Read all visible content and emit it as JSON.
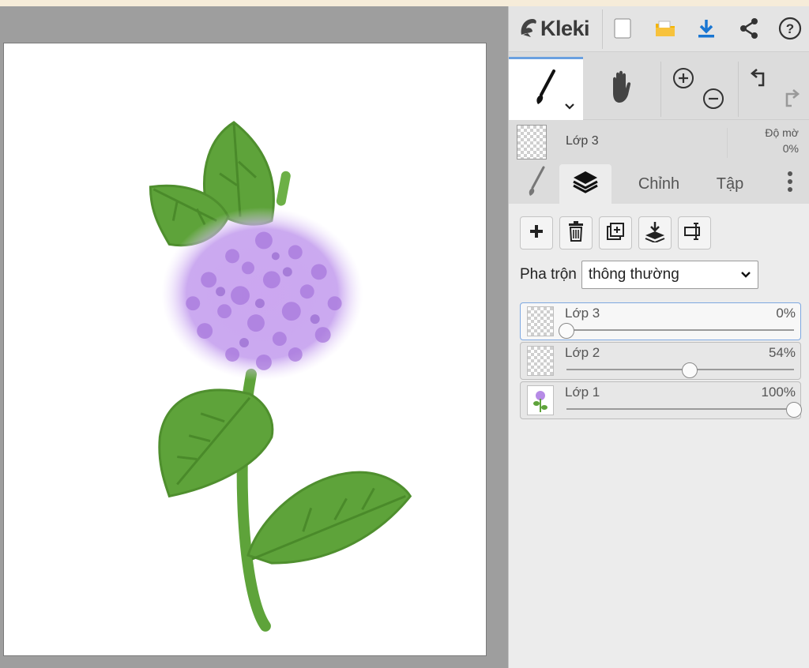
{
  "app": {
    "name": "Kleki"
  },
  "toolbar": {
    "icons": [
      "kleki-logo-icon",
      "new-file-icon",
      "open-folder-icon",
      "download-icon",
      "share-icon",
      "help-icon"
    ],
    "colors": {
      "folder": "#f4b400",
      "download": "#1976d2"
    }
  },
  "tools": [
    "brush-icon",
    "hand-icon",
    "zoom-in-icon",
    "zoom-out-icon",
    "undo-icon",
    "redo-icon"
  ],
  "layer_header": {
    "name": "Lớp 3",
    "opacity_label": "Độ mờ",
    "opacity_value": "0%"
  },
  "tabs": {
    "edit_label": "Chỉnh sửa",
    "file_label": "Tập tin"
  },
  "blend": {
    "label": "Pha trộn",
    "selected": "thông thường"
  },
  "layers": [
    {
      "name": "Lớp 3",
      "opacity": "0%",
      "level": 0.0,
      "selected": true
    },
    {
      "name": "Lớp 2",
      "opacity": "54%",
      "level": 0.54,
      "selected": false
    },
    {
      "name": "Lớp 1",
      "opacity": "100%",
      "level": 1.0,
      "selected": false
    }
  ],
  "colors": {
    "accent": "#6aa0e0",
    "leaf": "#5ea33a",
    "flower": "#b68be6"
  }
}
